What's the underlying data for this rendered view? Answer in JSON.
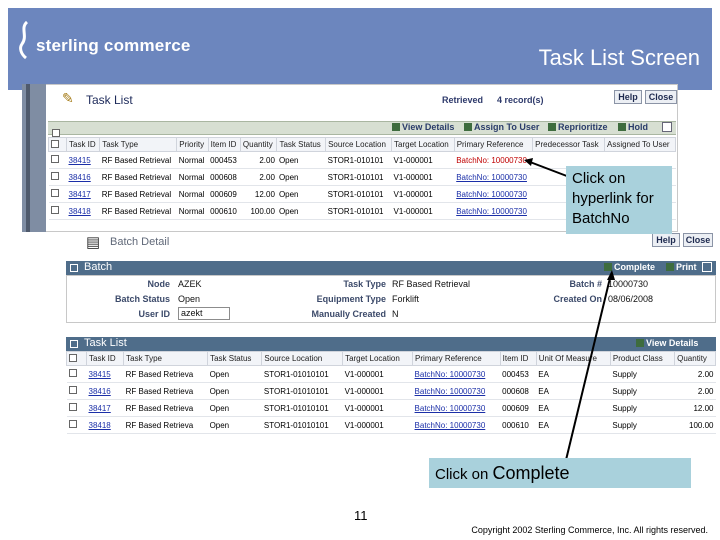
{
  "header": {
    "brand": "sterling commerce",
    "slide_title": "Task List Screen"
  },
  "task_list": {
    "title": "Task List",
    "retrieved_label": "Retrieved",
    "retrieved_count": "4  record(s)",
    "help": "Help",
    "close": "Close",
    "toolbar": {
      "view_details": "View Details",
      "assign_to_user": "Assign To User",
      "reprioritize": "Reprioritize",
      "hold": "Hold"
    },
    "columns": [
      "Task ID",
      "Task Type",
      "Priority",
      "Item ID",
      "Quantity",
      "Task Status",
      "Source Location",
      "Target Location",
      "Primary Reference",
      "Predecessor Task",
      "Assigned To User"
    ],
    "rows": [
      {
        "task_id": "38415",
        "task_type": "RF Based Retrieval",
        "priority": "Normal",
        "item_id": "000453",
        "quantity": "2.00",
        "status": "Open",
        "source": "STOR1-010101",
        "target": "V1-000001",
        "reference": "BatchNo: 10000730"
      },
      {
        "task_id": "38416",
        "task_type": "RF Based Retrieval",
        "priority": "Normal",
        "item_id": "000608",
        "quantity": "2.00",
        "status": "Open",
        "source": "STOR1-010101",
        "target": "V1-000001",
        "reference": "BatchNo: 10000730"
      },
      {
        "task_id": "38417",
        "task_type": "RF Based Retrieval",
        "priority": "Normal",
        "item_id": "000609",
        "quantity": "12.00",
        "status": "Open",
        "source": "STOR1-010101",
        "target": "V1-000001",
        "reference": "BatchNo: 10000730"
      },
      {
        "task_id": "38418",
        "task_type": "RF Based Retrieval",
        "priority": "Normal",
        "item_id": "000610",
        "quantity": "100.00",
        "status": "Open",
        "source": "STOR1-010101",
        "target": "V1-000001",
        "reference": "BatchNo: 10000730"
      }
    ]
  },
  "batch_detail": {
    "title": "Batch Detail",
    "help": "Help",
    "close": "Close",
    "section_title": "Batch",
    "complete": "Complete",
    "print": "Print",
    "fields": {
      "node_label": "Node",
      "node_value": "AZEK",
      "batch_status_label": "Batch Status",
      "batch_status_value": "Open",
      "user_id_label": "User ID",
      "user_id_value": "azekt",
      "task_type_label": "Task Type",
      "task_type_value": "RF Based Retrieval",
      "equipment_type_label": "Equipment Type",
      "equipment_type_value": "Forklift",
      "manually_created_label": "Manually Created",
      "manually_created_value": "N",
      "batch_no_label": "Batch #",
      "batch_no_value": "10000730",
      "created_on_label": "Created On",
      "created_on_value": "08/06/2008"
    },
    "task_list_title": "Task List",
    "view_details": "View Details",
    "columns": [
      "Task ID",
      "Task Type",
      "Task Status",
      "Source Location",
      "Target Location",
      "Primary Reference",
      "Item ID",
      "Unit Of Measure",
      "Product Class",
      "Quantity"
    ],
    "rows": [
      {
        "task_id": "38415",
        "task_type": "RF Based Retrieva",
        "status": "Open",
        "source": "STOR1-01010101",
        "target": "V1-000001",
        "reference": "BatchNo: 10000730",
        "item_id": "000453",
        "uom": "EA",
        "class": "Supply",
        "quantity": "2.00"
      },
      {
        "task_id": "38416",
        "task_type": "RF Based Retrieva",
        "status": "Open",
        "source": "STOR1-01010101",
        "target": "V1-000001",
        "reference": "BatchNo: 10000730",
        "item_id": "000608",
        "uom": "EA",
        "class": "Supply",
        "quantity": "2.00"
      },
      {
        "task_id": "38417",
        "task_type": "RF Based Retrieva",
        "status": "Open",
        "source": "STOR1-01010101",
        "target": "V1-000001",
        "reference": "BatchNo: 10000730",
        "item_id": "000609",
        "uom": "EA",
        "class": "Supply",
        "quantity": "12.00"
      },
      {
        "task_id": "38418",
        "task_type": "RF Based Retrieva",
        "status": "Open",
        "source": "STOR1-01010101",
        "target": "V1-000001",
        "reference": "BatchNo: 10000730",
        "item_id": "000610",
        "uom": "EA",
        "class": "Supply",
        "quantity": "100.00"
      }
    ]
  },
  "callouts": {
    "hyperlink": "Click on hyperlink for BatchNo",
    "complete_prefix": "Click on ",
    "complete_word": "Complete"
  },
  "footer": {
    "page_number": "11",
    "copyright": "Copyright 2002 Sterling Commerce, Inc. All rights reserved."
  }
}
